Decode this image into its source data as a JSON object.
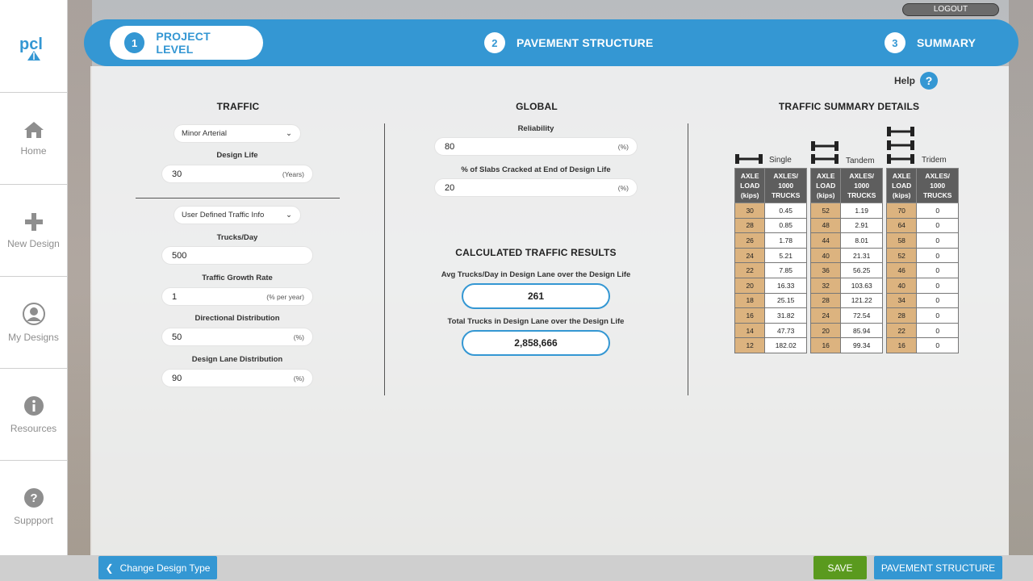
{
  "header": {
    "logout": "LOGOUT",
    "help": "Help",
    "steps": [
      {
        "num": "1",
        "label": "PROJECT LEVEL"
      },
      {
        "num": "2",
        "label": "PAVEMENT STRUCTURE"
      },
      {
        "num": "3",
        "label": "SUMMARY"
      }
    ]
  },
  "sidebar": {
    "logo": "pcl",
    "items": [
      {
        "label": "Home",
        "icon": "home-icon"
      },
      {
        "label": "New Design",
        "icon": "plus-icon"
      },
      {
        "label": "My Designs",
        "icon": "user-icon"
      },
      {
        "label": "Resources",
        "icon": "info-icon"
      },
      {
        "label": "Suppport",
        "icon": "question-icon"
      }
    ]
  },
  "traffic": {
    "title": "TRAFFIC",
    "road_class": "Minor Arterial",
    "design_life_label": "Design Life",
    "design_life": "30",
    "design_life_unit": "(Years)",
    "traffic_info": "User Defined Traffic Info",
    "trucks_day_label": "Trucks/Day",
    "trucks_day": "500",
    "growth_label": "Traffic Growth Rate",
    "growth": "1",
    "growth_unit": "(% per year)",
    "directional_label": "Directional Distribution",
    "directional": "50",
    "directional_unit": "(%)",
    "lane_label": "Design Lane Distribution",
    "lane": "90",
    "lane_unit": "(%)"
  },
  "global": {
    "title": "GLOBAL",
    "reliability_label": "Reliability",
    "reliability": "80",
    "reliability_unit": "(%)",
    "slabs_label": "% of Slabs Cracked at End of Design Life",
    "slabs": "20",
    "slabs_unit": "(%)"
  },
  "results": {
    "title": "CALCULATED TRAFFIC RESULTS",
    "avg_label": "Avg Trucks/Day in Design Lane over the Design Life",
    "avg": "261",
    "total_label": "Total Trucks in Design Lane over the Design Life",
    "total": "2,858,666"
  },
  "summary": {
    "title": "TRAFFIC SUMMARY DETAILS",
    "col_load": "AXLE LOAD (kips)",
    "col_axles": "AXLES/ 1000 TRUCKS",
    "single": {
      "label": "Single",
      "rows": [
        [
          "30",
          "0.45"
        ],
        [
          "28",
          "0.85"
        ],
        [
          "26",
          "1.78"
        ],
        [
          "24",
          "5.21"
        ],
        [
          "22",
          "7.85"
        ],
        [
          "20",
          "16.33"
        ],
        [
          "18",
          "25.15"
        ],
        [
          "16",
          "31.82"
        ],
        [
          "14",
          "47.73"
        ],
        [
          "12",
          "182.02"
        ]
      ]
    },
    "tandem": {
      "label": "Tandem",
      "rows": [
        [
          "52",
          "1.19"
        ],
        [
          "48",
          "2.91"
        ],
        [
          "44",
          "8.01"
        ],
        [
          "40",
          "21.31"
        ],
        [
          "36",
          "56.25"
        ],
        [
          "32",
          "103.63"
        ],
        [
          "28",
          "121.22"
        ],
        [
          "24",
          "72.54"
        ],
        [
          "20",
          "85.94"
        ],
        [
          "16",
          "99.34"
        ]
      ]
    },
    "tridem": {
      "label": "Tridem",
      "rows": [
        [
          "70",
          "0"
        ],
        [
          "64",
          "0"
        ],
        [
          "58",
          "0"
        ],
        [
          "52",
          "0"
        ],
        [
          "46",
          "0"
        ],
        [
          "40",
          "0"
        ],
        [
          "34",
          "0"
        ],
        [
          "28",
          "0"
        ],
        [
          "22",
          "0"
        ],
        [
          "16",
          "0"
        ]
      ]
    }
  },
  "footer": {
    "change": "Change Design Type",
    "save": "SAVE",
    "next": "PAVEMENT STRUCTURE"
  },
  "colors": {
    "accent": "#3497d3",
    "save": "#5a9a1e",
    "load_cell": "#dcb37f"
  }
}
